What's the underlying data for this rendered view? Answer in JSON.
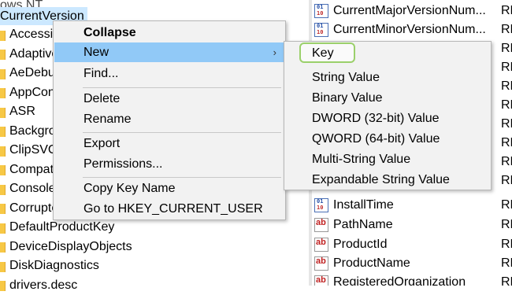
{
  "tree": {
    "parent_label": "ows NT",
    "selected_key": "CurrentVersion",
    "items": [
      "Accessib",
      "Adaptive",
      "AeDebu",
      "AppCon",
      "ASR",
      "Backgro",
      "ClipSVC",
      "Compat",
      "Console",
      "Corrupte",
      "DefaultProductKey",
      "DeviceDisplayObjects",
      "DiskDiagnostics",
      "drivers.desc"
    ]
  },
  "values": {
    "rows": [
      {
        "name": "CurrentMajorVersionNum...",
        "type": "RE",
        "icon": "binary-value-icon"
      },
      {
        "name": "CurrentMinorVersionNum...",
        "type": "RE",
        "icon": "binary-value-icon"
      },
      {
        "name": "",
        "type": "RE",
        "icon": ""
      },
      {
        "name": "",
        "type": "RE",
        "icon": ""
      },
      {
        "name": "",
        "type": "RE",
        "icon": ""
      },
      {
        "name": "",
        "type": "RE",
        "icon": ""
      },
      {
        "name": "",
        "type": "RE",
        "icon": ""
      },
      {
        "name": "",
        "type": "RE",
        "icon": ""
      },
      {
        "name": "",
        "type": "RE",
        "icon": ""
      },
      {
        "name": "",
        "type": "RE",
        "icon": ""
      },
      {
        "name": "InstallTime",
        "type": "RE",
        "icon": "binary-value-icon"
      },
      {
        "name": "PathName",
        "type": "RE",
        "icon": "string-value-icon"
      },
      {
        "name": "ProductId",
        "type": "RE",
        "icon": "string-value-icon"
      },
      {
        "name": "ProductName",
        "type": "RE",
        "icon": "string-value-icon"
      },
      {
        "name": "RegisteredOrganization",
        "type": "RE",
        "icon": "string-value-icon"
      }
    ]
  },
  "context_menu": {
    "collapse": "Collapse",
    "new": "New",
    "find": "Find...",
    "delete": "Delete",
    "rename": "Rename",
    "export": "Export",
    "permissions": "Permissions...",
    "copy_key_name": "Copy Key Name",
    "goto": "Go to HKEY_CURRENT_USER",
    "submenu_arrow": "›"
  },
  "new_submenu": {
    "key": "Key",
    "string_value": "String Value",
    "binary_value": "Binary Value",
    "dword_value": "DWORD (32-bit) Value",
    "qword_value": "QWORD (64-bit) Value",
    "multi_string_value": "Multi-String Value",
    "expandable_string_value": "Expandable String Value"
  },
  "colors": {
    "selection": "#cce8ff",
    "menu_hover": "#91c9f7",
    "key_highlight_border": "#9bd06b",
    "folder": "#f7c845"
  }
}
